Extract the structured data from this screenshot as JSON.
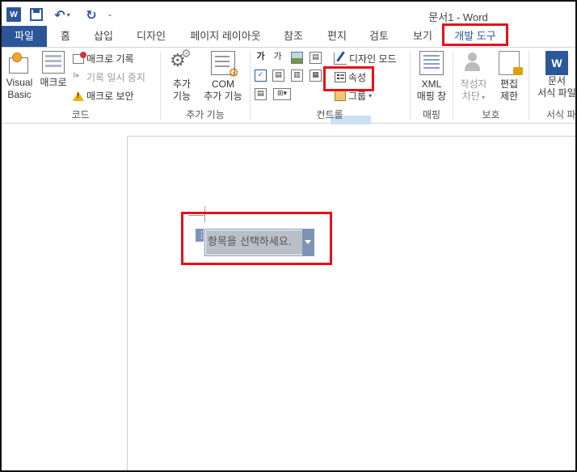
{
  "window": {
    "title": "문서1 - Word"
  },
  "quick_access": {
    "app_icon": "W",
    "undo_icon": "↶",
    "redo_icon": "↻",
    "more_icon": "⌄"
  },
  "tabs": [
    {
      "label": "파일"
    },
    {
      "label": "홈"
    },
    {
      "label": "삽입"
    },
    {
      "label": "디자인"
    },
    {
      "label": "페이지 레이아웃"
    },
    {
      "label": "참조"
    },
    {
      "label": "편지"
    },
    {
      "label": "검토"
    },
    {
      "label": "보기"
    },
    {
      "label": "개발 도구"
    }
  ],
  "ribbon": {
    "code": {
      "label": "코드",
      "visual_basic": [
        "Visual",
        "Basic"
      ],
      "macros": "매크로",
      "record_macro": "매크로 기록",
      "pause_recording": "기록 일시 중지",
      "macro_security": "매크로 보안"
    },
    "addins": {
      "label": "추가 기능",
      "addins_btn": [
        "추가",
        "기능"
      ],
      "com_addins": [
        "COM",
        "추가 기능"
      ]
    },
    "controls": {
      "label": "컨트롤",
      "rich_text_glyph": "가",
      "plain_text_glyph": "가",
      "design_mode": "디자인 모드",
      "properties": "속성",
      "group": "그룹"
    },
    "mapping": {
      "label": "매핑",
      "xml_pane": [
        "XML",
        "매핑 창"
      ]
    },
    "protect": {
      "label": "보호",
      "block_authors": [
        "작성자",
        "차단"
      ],
      "restrict_editing": [
        "편집",
        "제한"
      ]
    },
    "templates": {
      "label": "서식 파",
      "document_template": [
        "문서",
        "서식 파일"
      ],
      "icon_letter": "W"
    }
  },
  "document": {
    "content_control_placeholder": "항목을 선택하세요."
  },
  "colors": {
    "accent": "#2b579a",
    "highlight_box": "#e8101a",
    "control_bg": "#b9bfc7"
  }
}
